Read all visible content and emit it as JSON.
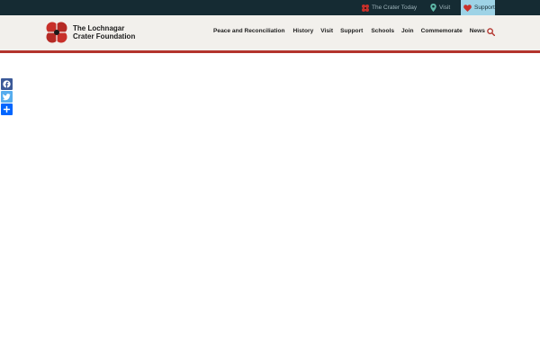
{
  "topbar": {
    "links": [
      {
        "label": "The Crater Today",
        "icon": "poppy-icon"
      },
      {
        "label": "Visit",
        "icon": "map-pin-icon"
      },
      {
        "label": "Support",
        "icon": "heart-icon"
      }
    ]
  },
  "logo": {
    "line1": "The Lochnagar",
    "line2": "Crater Foundation"
  },
  "nav": {
    "items": [
      "Peace and Reconciliation",
      "History",
      "Visit",
      "Support",
      "Schools",
      "Join",
      "Commemorate",
      "News"
    ]
  },
  "share": {
    "buttons": [
      "facebook-icon",
      "twitter-icon",
      "share-plus-icon"
    ]
  },
  "colors": {
    "topbar": "#152b33",
    "header": "#f2f0ec",
    "accent_red": "#b3342d",
    "support_bg": "#9ed3e6"
  }
}
